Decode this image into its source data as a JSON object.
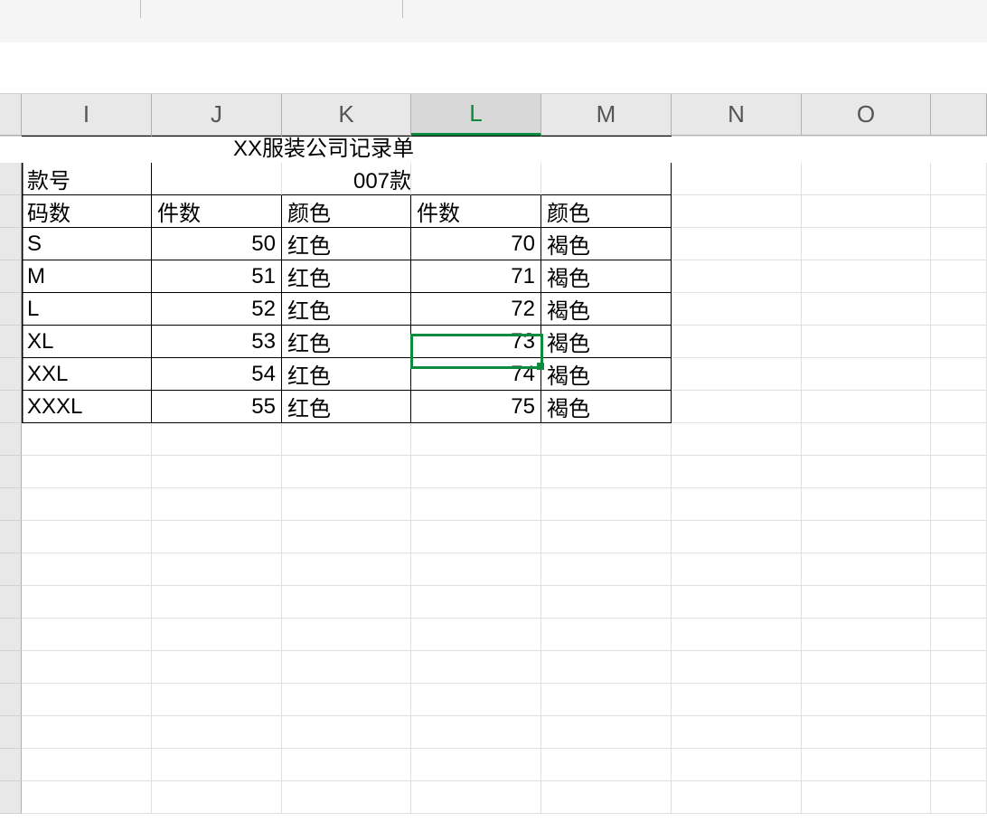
{
  "columns": [
    "I",
    "J",
    "K",
    "L",
    "M",
    "N",
    "O"
  ],
  "selectedCol": "L",
  "title": "XX服装公司记录单",
  "styleRow": {
    "label": "款号",
    "value": "007款"
  },
  "headers": {
    "size": "码数",
    "qty1": "件数",
    "color1": "颜色",
    "qty2": "件数",
    "color2": "颜色"
  },
  "rows": [
    {
      "size": "S",
      "qty1": 50,
      "color1": "红色",
      "qty2": 70,
      "color2": "褐色"
    },
    {
      "size": "M",
      "qty1": 51,
      "color1": "红色",
      "qty2": 71,
      "color2": "褐色"
    },
    {
      "size": "L",
      "qty1": 52,
      "color1": "红色",
      "qty2": 72,
      "color2": "褐色"
    },
    {
      "size": "XL",
      "qty1": 53,
      "color1": "红色",
      "qty2": 73,
      "color2": "褐色"
    },
    {
      "size": "XXL",
      "qty1": 54,
      "color1": "红色",
      "qty2": 74,
      "color2": "褐色"
    },
    {
      "size": "XXXL",
      "qty1": 55,
      "color1": "红色",
      "qty2": 75,
      "color2": "褐色"
    }
  ],
  "emptyRows": 12
}
